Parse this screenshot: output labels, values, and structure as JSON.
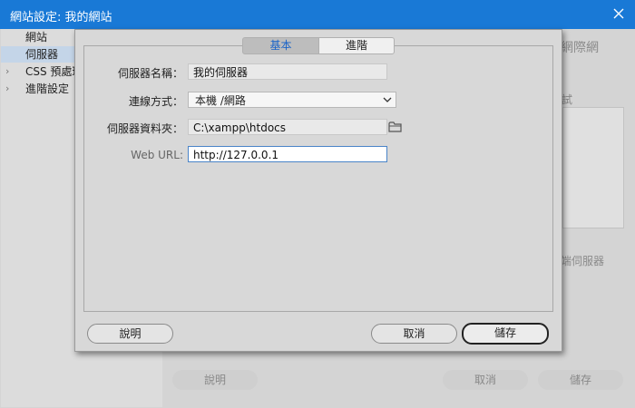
{
  "window": {
    "title": "網站設定: 我的網站"
  },
  "sidebar": {
    "items": [
      {
        "label": "網站",
        "has_chevron": false,
        "selected": false
      },
      {
        "label": "伺服器",
        "has_chevron": false,
        "selected": true
      },
      {
        "label": "CSS 預處理",
        "has_chevron": true,
        "selected": false
      },
      {
        "label": "進階設定",
        "has_chevron": true,
        "selected": false
      }
    ]
  },
  "background": {
    "partial_text_1": "網際網",
    "partial_text_2": "試",
    "partial_text_3": "端伺服器",
    "help_label": "說明",
    "cancel_label": "取消",
    "save_label": "儲存"
  },
  "dialog": {
    "tabs": [
      {
        "label": "基本",
        "active": true
      },
      {
        "label": "進階",
        "active": false
      }
    ],
    "fields": {
      "server_name": {
        "label": "伺服器名稱：",
        "value": "我的伺服器"
      },
      "connect_method": {
        "label": "連線方式：",
        "value": "本機 /網路"
      },
      "server_folder": {
        "label": "伺服器資料夾：",
        "value": "C:\\xampp\\htdocs"
      },
      "web_url": {
        "label": "Web URL:",
        "value": "http://127.0.0.1"
      }
    },
    "buttons": {
      "help": "說明",
      "cancel": "取消",
      "save": "儲存"
    }
  },
  "icons": {
    "close": "close-icon",
    "folder": "folder-icon",
    "chevron": "chevron-down-icon",
    "expand": "chevron-right-icon"
  },
  "colors": {
    "titlebar": "#1979d6",
    "active_tab_text": "#1a64c8",
    "sidebar_selected": "#c4d5e8",
    "focus_border": "#4a84c8"
  }
}
